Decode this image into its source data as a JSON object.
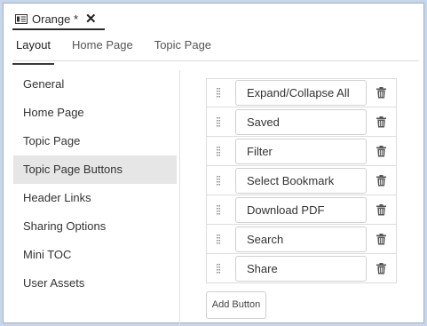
{
  "document_tab": {
    "title": "Orange *",
    "close_glyph": "✕",
    "icon": "document-icon"
  },
  "tabs": [
    {
      "label": "Layout",
      "active": true
    },
    {
      "label": "Home Page",
      "active": false
    },
    {
      "label": "Topic Page",
      "active": false
    }
  ],
  "sidebar": {
    "items": [
      {
        "label": "General"
      },
      {
        "label": "Home Page"
      },
      {
        "label": "Topic Page"
      },
      {
        "label": "Topic Page Buttons",
        "selected": true
      },
      {
        "label": "Header Links"
      },
      {
        "label": "Sharing Options"
      },
      {
        "label": "Mini TOC"
      },
      {
        "label": "User Assets"
      }
    ]
  },
  "buttons": {
    "items": [
      {
        "label": "Expand/Collapse All"
      },
      {
        "label": "Saved"
      },
      {
        "label": "Filter"
      },
      {
        "label": "Select Bookmark"
      },
      {
        "label": "Download PDF"
      },
      {
        "label": "Search"
      },
      {
        "label": "Share"
      }
    ],
    "handle_icon": "drag-handle-icon",
    "delete_icon": "trash-icon",
    "add_label": "Add Button"
  },
  "colors": {
    "frame_border": "#c7d6e8",
    "selected_bg": "#e6e6e6",
    "accent_underline": "#2b2b2b"
  }
}
